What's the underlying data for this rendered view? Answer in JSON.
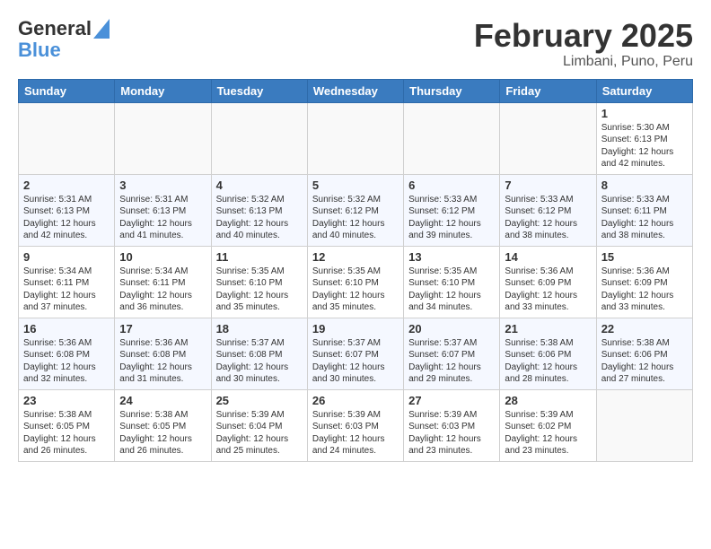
{
  "header": {
    "logo_line1": "General",
    "logo_line2": "Blue",
    "month": "February 2025",
    "location": "Limbani, Puno, Peru"
  },
  "days_of_week": [
    "Sunday",
    "Monday",
    "Tuesday",
    "Wednesday",
    "Thursday",
    "Friday",
    "Saturday"
  ],
  "weeks": [
    [
      {
        "day": "",
        "info": ""
      },
      {
        "day": "",
        "info": ""
      },
      {
        "day": "",
        "info": ""
      },
      {
        "day": "",
        "info": ""
      },
      {
        "day": "",
        "info": ""
      },
      {
        "day": "",
        "info": ""
      },
      {
        "day": "1",
        "info": "Sunrise: 5:30 AM\nSunset: 6:13 PM\nDaylight: 12 hours\nand 42 minutes."
      }
    ],
    [
      {
        "day": "2",
        "info": "Sunrise: 5:31 AM\nSunset: 6:13 PM\nDaylight: 12 hours\nand 42 minutes."
      },
      {
        "day": "3",
        "info": "Sunrise: 5:31 AM\nSunset: 6:13 PM\nDaylight: 12 hours\nand 41 minutes."
      },
      {
        "day": "4",
        "info": "Sunrise: 5:32 AM\nSunset: 6:13 PM\nDaylight: 12 hours\nand 40 minutes."
      },
      {
        "day": "5",
        "info": "Sunrise: 5:32 AM\nSunset: 6:12 PM\nDaylight: 12 hours\nand 40 minutes."
      },
      {
        "day": "6",
        "info": "Sunrise: 5:33 AM\nSunset: 6:12 PM\nDaylight: 12 hours\nand 39 minutes."
      },
      {
        "day": "7",
        "info": "Sunrise: 5:33 AM\nSunset: 6:12 PM\nDaylight: 12 hours\nand 38 minutes."
      },
      {
        "day": "8",
        "info": "Sunrise: 5:33 AM\nSunset: 6:11 PM\nDaylight: 12 hours\nand 38 minutes."
      }
    ],
    [
      {
        "day": "9",
        "info": "Sunrise: 5:34 AM\nSunset: 6:11 PM\nDaylight: 12 hours\nand 37 minutes."
      },
      {
        "day": "10",
        "info": "Sunrise: 5:34 AM\nSunset: 6:11 PM\nDaylight: 12 hours\nand 36 minutes."
      },
      {
        "day": "11",
        "info": "Sunrise: 5:35 AM\nSunset: 6:10 PM\nDaylight: 12 hours\nand 35 minutes."
      },
      {
        "day": "12",
        "info": "Sunrise: 5:35 AM\nSunset: 6:10 PM\nDaylight: 12 hours\nand 35 minutes."
      },
      {
        "day": "13",
        "info": "Sunrise: 5:35 AM\nSunset: 6:10 PM\nDaylight: 12 hours\nand 34 minutes."
      },
      {
        "day": "14",
        "info": "Sunrise: 5:36 AM\nSunset: 6:09 PM\nDaylight: 12 hours\nand 33 minutes."
      },
      {
        "day": "15",
        "info": "Sunrise: 5:36 AM\nSunset: 6:09 PM\nDaylight: 12 hours\nand 33 minutes."
      }
    ],
    [
      {
        "day": "16",
        "info": "Sunrise: 5:36 AM\nSunset: 6:08 PM\nDaylight: 12 hours\nand 32 minutes."
      },
      {
        "day": "17",
        "info": "Sunrise: 5:36 AM\nSunset: 6:08 PM\nDaylight: 12 hours\nand 31 minutes."
      },
      {
        "day": "18",
        "info": "Sunrise: 5:37 AM\nSunset: 6:08 PM\nDaylight: 12 hours\nand 30 minutes."
      },
      {
        "day": "19",
        "info": "Sunrise: 5:37 AM\nSunset: 6:07 PM\nDaylight: 12 hours\nand 30 minutes."
      },
      {
        "day": "20",
        "info": "Sunrise: 5:37 AM\nSunset: 6:07 PM\nDaylight: 12 hours\nand 29 minutes."
      },
      {
        "day": "21",
        "info": "Sunrise: 5:38 AM\nSunset: 6:06 PM\nDaylight: 12 hours\nand 28 minutes."
      },
      {
        "day": "22",
        "info": "Sunrise: 5:38 AM\nSunset: 6:06 PM\nDaylight: 12 hours\nand 27 minutes."
      }
    ],
    [
      {
        "day": "23",
        "info": "Sunrise: 5:38 AM\nSunset: 6:05 PM\nDaylight: 12 hours\nand 26 minutes."
      },
      {
        "day": "24",
        "info": "Sunrise: 5:38 AM\nSunset: 6:05 PM\nDaylight: 12 hours\nand 26 minutes."
      },
      {
        "day": "25",
        "info": "Sunrise: 5:39 AM\nSunset: 6:04 PM\nDaylight: 12 hours\nand 25 minutes."
      },
      {
        "day": "26",
        "info": "Sunrise: 5:39 AM\nSunset: 6:03 PM\nDaylight: 12 hours\nand 24 minutes."
      },
      {
        "day": "27",
        "info": "Sunrise: 5:39 AM\nSunset: 6:03 PM\nDaylight: 12 hours\nand 23 minutes."
      },
      {
        "day": "28",
        "info": "Sunrise: 5:39 AM\nSunset: 6:02 PM\nDaylight: 12 hours\nand 23 minutes."
      },
      {
        "day": "",
        "info": ""
      }
    ]
  ]
}
